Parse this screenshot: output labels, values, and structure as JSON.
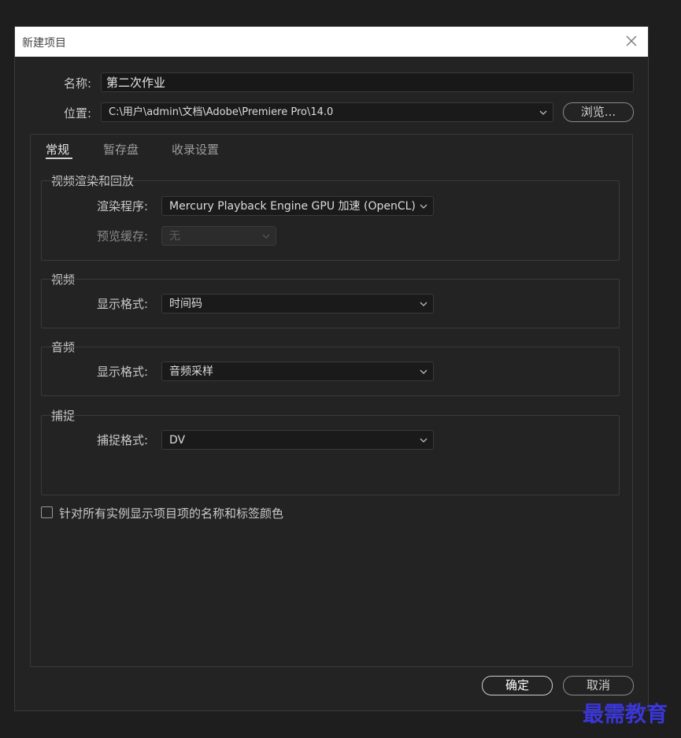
{
  "dialog": {
    "title": "新建项目",
    "close_icon": "close-icon"
  },
  "fields": {
    "name_label": "名称:",
    "name_value": "第二次作业",
    "location_label": "位置:",
    "location_value": "C:\\用户\\admin\\文档\\Adobe\\Premiere Pro\\14.0",
    "browse_label": "浏览..."
  },
  "tabs": [
    {
      "label": "常规",
      "active": true
    },
    {
      "label": "暂存盘",
      "active": false
    },
    {
      "label": "收录设置",
      "active": false
    }
  ],
  "groups": {
    "render": {
      "title": "视频渲染和回放",
      "renderer_label": "渲染程序:",
      "renderer_value": "Mercury Playback Engine GPU 加速 (OpenCL)",
      "preview_cache_label": "预览缓存:",
      "preview_cache_value": "无"
    },
    "video": {
      "title": "视频",
      "display_format_label": "显示格式:",
      "display_format_value": "时间码"
    },
    "audio": {
      "title": "音频",
      "display_format_label": "显示格式:",
      "display_format_value": "音频采样"
    },
    "capture": {
      "title": "捕捉",
      "capture_format_label": "捕捉格式:",
      "capture_format_value": "DV"
    }
  },
  "checkbox": {
    "label": "针对所有实例显示项目项的名称和标签颜色",
    "checked": false
  },
  "buttons": {
    "ok": "确定",
    "cancel": "取消"
  },
  "watermark": "最需教育",
  "colors": {
    "background": "#1e1e1e",
    "dialog": "#232323",
    "watermark": "#3a36d8"
  }
}
